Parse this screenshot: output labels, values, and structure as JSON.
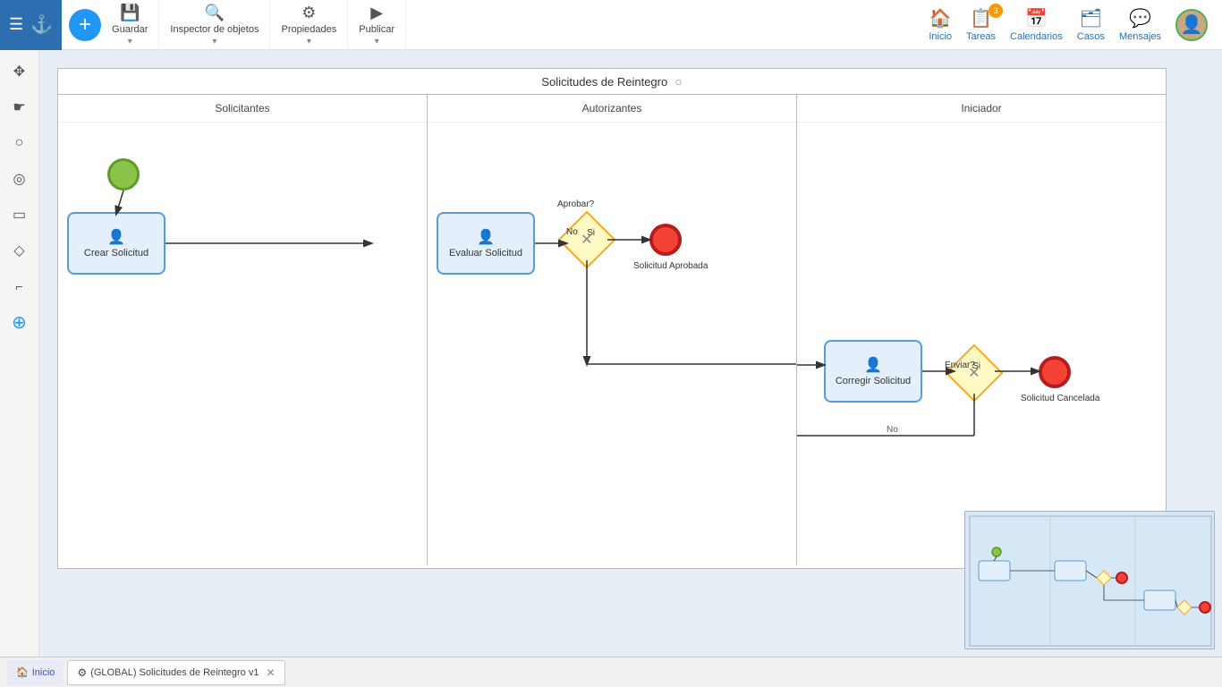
{
  "toolbar": {
    "save_label": "Guardar",
    "inspector_label": "Inspector de objetos",
    "properties_label": "Propiedades",
    "publish_label": "Publicar",
    "add_button_label": "+"
  },
  "nav": {
    "inicio_label": "Inicio",
    "tareas_label": "Tareas",
    "tareas_badge": "3",
    "calendarios_label": "Calendarios",
    "casos_label": "Casos",
    "mensajes_label": "Mensajes"
  },
  "diagram": {
    "title": "Solicitudes de Reintegro",
    "lanes": [
      {
        "id": "solicitantes",
        "label": "Solicitantes"
      },
      {
        "id": "autorizantes",
        "label": "Autorizantes"
      },
      {
        "id": "iniciador",
        "label": "Iniciador"
      }
    ],
    "elements": {
      "crear_solicitud": "Crear Solicitud",
      "evaluar_solicitud": "Evaluar Solicitud",
      "corregir_solicitud": "Corregir Solicitud",
      "solicitud_aprobada": "Solicitud Aprobada",
      "solicitud_cancelada": "Solicitud Cancelada",
      "aprobar_gateway_label": "Aprobar?",
      "enviar_gateway_label": "Enviar?",
      "si_label": "Si",
      "no_label": "No"
    }
  },
  "bottom_bar": {
    "home_label": "Inicio",
    "tab_label": "(GLOBAL) Solicitudes de Reintegro v1"
  },
  "sidebar_tools": [
    {
      "name": "move-tool",
      "icon": "✥"
    },
    {
      "name": "hand-tool",
      "icon": "☛"
    },
    {
      "name": "circle-outline-tool",
      "icon": "○"
    },
    {
      "name": "circle-filled-tool",
      "icon": "◎"
    },
    {
      "name": "rect-tool",
      "icon": "▭"
    },
    {
      "name": "diamond-tool",
      "icon": "◇"
    },
    {
      "name": "bracket-tool",
      "icon": "⌐"
    },
    {
      "name": "add-tool",
      "icon": "⊕"
    }
  ]
}
